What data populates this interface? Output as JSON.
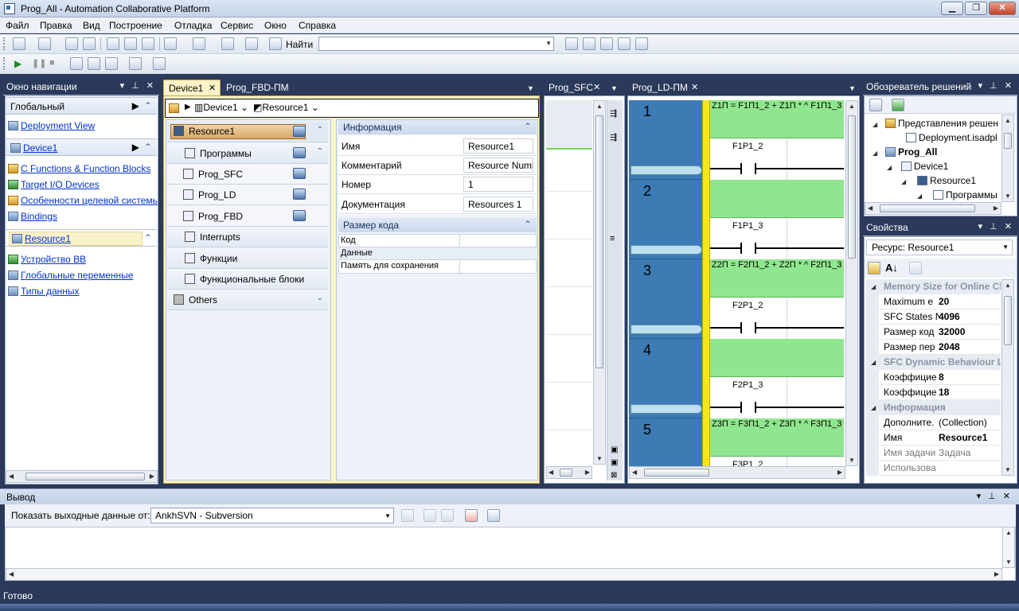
{
  "window": {
    "title": "Prog_All - Automation Collaborative Platform"
  },
  "menu": [
    "Файл",
    "Правка",
    "Вид",
    "Построение",
    "Отладка",
    "Сервис",
    "Окно",
    "Справка"
  ],
  "toolbar": {
    "find_label": "Найти",
    "find_value": ""
  },
  "nav": {
    "title": "Окно навигации",
    "global": "Глобальный",
    "deployment": "Deployment View",
    "device": "Device1",
    "device_links": [
      "C Functions & Function Blocks",
      "Target I/O Devices",
      "Особенности целевой системы",
      "Bindings"
    ],
    "resource": "Resource1",
    "resource_links": [
      "Устройство ВВ",
      "Глобальные переменные",
      "Типы данных"
    ]
  },
  "doc_tabs": {
    "device": "Device1",
    "fbd": "Prog_FBD-ПМ",
    "sfc": "Prog_SFC",
    "ld": "Prog_LD-ПМ"
  },
  "breadcrumb": {
    "device": "Device1",
    "resource": "Resource1"
  },
  "tree": {
    "resource": "Resource1",
    "programs": "Программы",
    "items": [
      "Prog_SFC",
      "Prog_LD",
      "Prog_FBD"
    ],
    "interrupts": "Interrupts",
    "functions": "Функции",
    "fblocks": "Функциональные блоки",
    "others": "Others"
  },
  "info": {
    "header": "Информация",
    "rows": [
      {
        "k": "Имя",
        "v": "Resource1"
      },
      {
        "k": "Комментарий",
        "v": "Resource Numb"
      },
      {
        "k": "Номер",
        "v": "1"
      },
      {
        "k": "Документация",
        "v": "Resources 1"
      }
    ],
    "code_header": "Размер кода",
    "code_rows": [
      "Код",
      "Данные",
      "Память для сохранения"
    ]
  },
  "ld": {
    "rungs": [
      {
        "num": "1",
        "expr": "Z1П = F1П1_2 + Z1П * ^ F1П1_3",
        "contact": "F1P1_2"
      },
      {
        "num": "2",
        "expr": "",
        "contact": "F1P1_3"
      },
      {
        "num": "3",
        "expr": "Z2П = F2П1_2 + Z2П * ^ F2П1_3",
        "contact": "F2P1_2"
      },
      {
        "num": "4",
        "expr": "",
        "contact": "F2P1_3"
      },
      {
        "num": "5",
        "expr": "Z3П = F3П1_2 + Z3П * ^ F3П1_3",
        "contact": "F3P1_2"
      }
    ]
  },
  "solution": {
    "title": "Обозреватель решений",
    "items": [
      "Представления решен",
      "Deployment.isadpl",
      "Prog_All",
      "Device1",
      "Resource1",
      "Программы"
    ]
  },
  "props": {
    "title": "Свойства",
    "selector": "Ресурс: Resource1",
    "rows": [
      {
        "cat": "Memory Size for Online Ch"
      },
      {
        "k": "Maximum e",
        "v": "20",
        "bold": true
      },
      {
        "k": "SFC States N",
        "v": "4096",
        "bold": true
      },
      {
        "k": "Размер код",
        "v": "32000",
        "bold": true
      },
      {
        "k": "Размер пер",
        "v": "2048",
        "bold": true
      },
      {
        "cat": "SFC Dynamic Behaviour Lim"
      },
      {
        "k": "Коэффицие",
        "v": "8",
        "bold": true
      },
      {
        "k": "Коэффицие",
        "v": "18",
        "bold": true
      },
      {
        "cat": "Информация"
      },
      {
        "k": "Дополните.",
        "v": "(Collection)"
      },
      {
        "k": "Имя",
        "v": "Resource1",
        "bold": true
      },
      {
        "k": "Имя задачи",
        "v": "Задача",
        "grey": true
      },
      {
        "k": "Использова",
        "v": "",
        "grey": true
      }
    ]
  },
  "output": {
    "title": "Вывод",
    "show_label": "Показать выходные данные от:",
    "source": "AnkhSVN - Subversion"
  },
  "status": "Готово"
}
